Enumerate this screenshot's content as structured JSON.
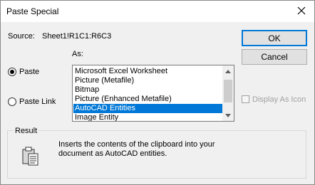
{
  "window": {
    "title": "Paste Special",
    "close_icon": "close-icon"
  },
  "source": {
    "label": "Source:",
    "value": "Sheet1!R1C1:R6C3"
  },
  "buttons": {
    "ok": "OK",
    "cancel": "Cancel"
  },
  "as_label": "As:",
  "options": {
    "paste": "Paste",
    "paste_link": "Paste Link",
    "selected": "Paste"
  },
  "list": {
    "items": [
      "Microsoft Excel Worksheet",
      "Picture (Metafile)",
      "Bitmap",
      "Picture (Enhanced Metafile)",
      "AutoCAD Entities",
      "Image Entity"
    ],
    "selected_index": 4
  },
  "display_as_icon": {
    "label": "Display As Icon",
    "checked": false,
    "enabled": false
  },
  "result": {
    "label": "Result",
    "text_line1": "Inserts the contents of the clipboard into your",
    "text_line2": "document as AutoCAD entities.",
    "icon": "clipboard-paste-icon"
  },
  "colors": {
    "accent": "#0078d7",
    "background": "#f0f0f0"
  }
}
